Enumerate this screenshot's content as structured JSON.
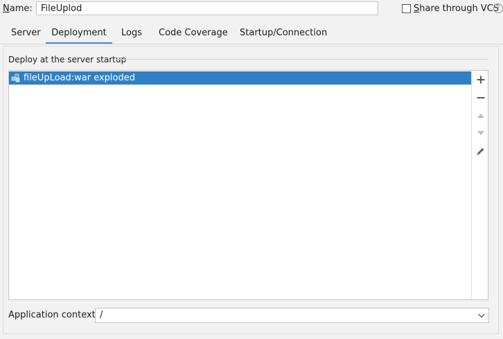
{
  "name_label_prefix": "N",
  "name_label_rest": "ame:",
  "name_value": "FileUplod",
  "share_label_prefix": "S",
  "share_label_rest": "hare through VCS",
  "help_glyph": "?",
  "tabs": [
    {
      "label": "Server"
    },
    {
      "label": "Deployment"
    },
    {
      "label": "Logs"
    },
    {
      "label": "Code Coverage"
    },
    {
      "label": "Startup/Connection"
    }
  ],
  "active_tab": "Deployment",
  "deploy_group_title": "Deploy at the server startup",
  "deploy_items": [
    {
      "label": "fileUpLoad:war exploded",
      "selected": true
    }
  ],
  "toolbar_icons": [
    "add-icon",
    "remove-icon",
    "move-up-icon",
    "move-down-icon",
    "edit-icon"
  ],
  "app_context_label": "Application context:",
  "app_context_value": "/",
  "colors": {
    "selection": "#2f7fc5",
    "active_tab_underline": "#4a88c7",
    "background": "#f2f2f2"
  }
}
